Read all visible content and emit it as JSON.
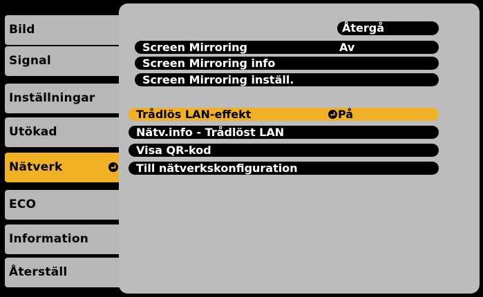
{
  "tabs": [
    {
      "label": "Bild"
    },
    {
      "label": "Signal"
    },
    {
      "label": "Inställningar"
    },
    {
      "label": "Utökad"
    },
    {
      "label": "Nätverk"
    },
    {
      "label": "ECO"
    },
    {
      "label": "Information"
    },
    {
      "label": "Återställ"
    }
  ],
  "panel": {
    "back_label": "Återgå",
    "options": [
      {
        "label": "Screen Mirroring",
        "value": "Av"
      },
      {
        "label": "Screen Mirroring info"
      },
      {
        "label": "Screen Mirroring inställ."
      },
      {
        "label": "Trådlös LAN-effekt",
        "value": "På"
      },
      {
        "label": "Nätv.info - Trådlöst LAN"
      },
      {
        "label": "Visa QR-kod"
      },
      {
        "label": "Till nätverkskonfiguration"
      }
    ]
  },
  "colors": {
    "highlight": "#f0b125",
    "tab_gray": "#b7b7b9",
    "panel_gray": "#bcbcbe"
  }
}
